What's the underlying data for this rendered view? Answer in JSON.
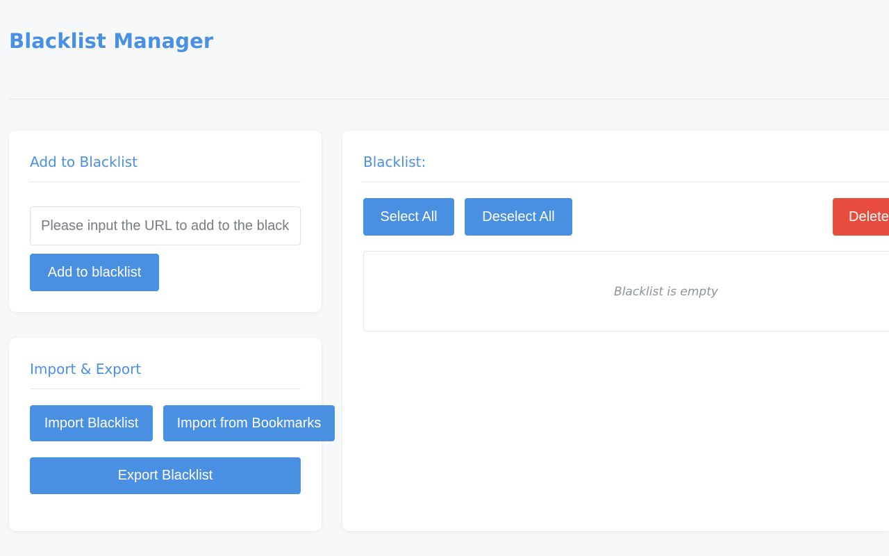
{
  "header": {
    "title": "Blacklist Manager"
  },
  "add_card": {
    "title": "Add to Blacklist",
    "input_placeholder": "Please input the URL to add to the blacklist",
    "input_value": "",
    "add_button_label": "Add to blacklist"
  },
  "import_export_card": {
    "title": "Import & Export",
    "import_button_label": "Import Blacklist",
    "import_bookmarks_button_label": "Import from Bookmarks",
    "export_button_label": "Export Blacklist"
  },
  "blacklist_card": {
    "title": "Blacklist:",
    "select_all_label": "Select All",
    "deselect_all_label": "Deselect All",
    "delete_label": "Delete",
    "empty_message": "Blacklist is empty"
  },
  "colors": {
    "accent": "#4a90e2",
    "danger": "#e74c3c",
    "background": "#f7f8fa"
  }
}
